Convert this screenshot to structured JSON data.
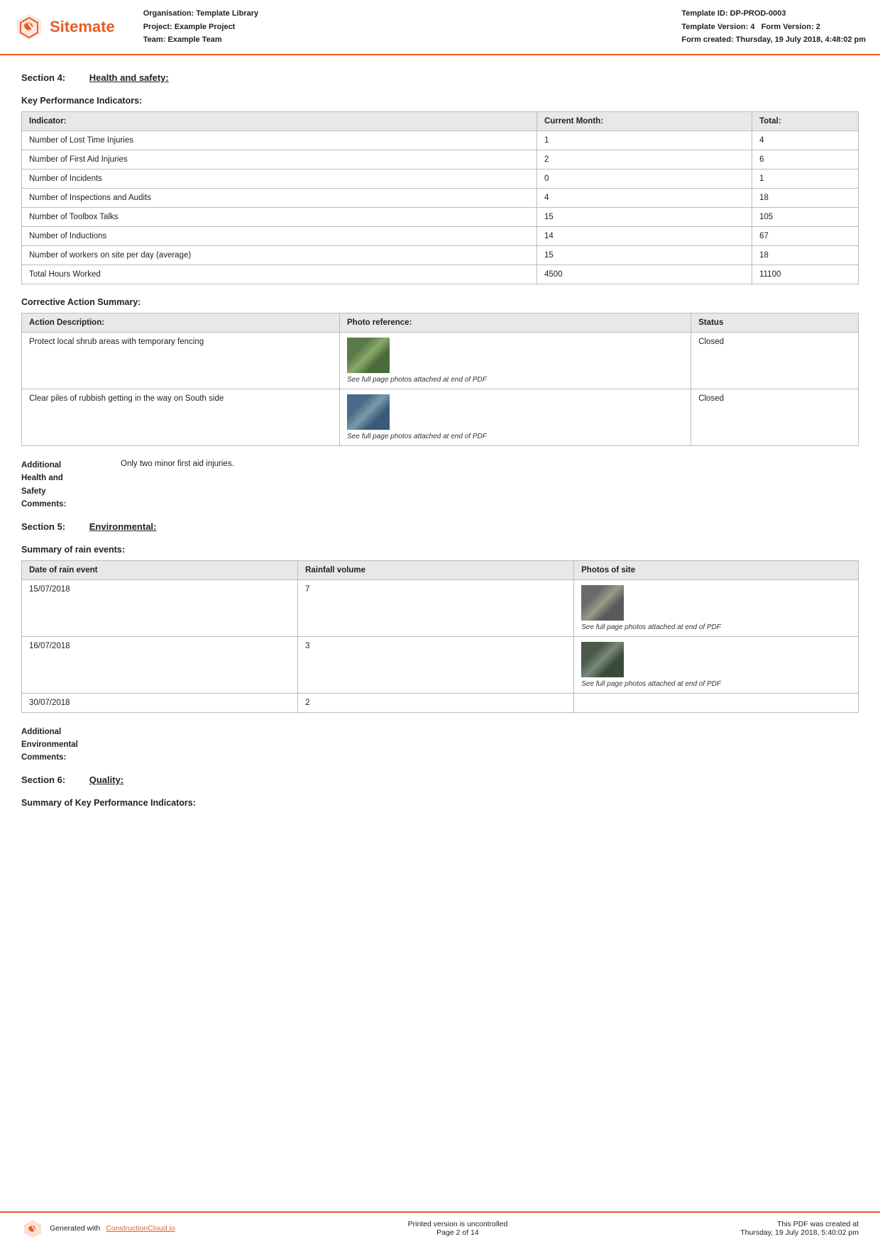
{
  "header": {
    "org_label": "Organisation:",
    "org_value": "Template Library",
    "project_label": "Project:",
    "project_value": "Example Project",
    "team_label": "Team:",
    "team_value": "Example Team",
    "template_id_label": "Template ID:",
    "template_id_value": "DP-PROD-0003",
    "template_version_label": "Template Version:",
    "template_version_value": "4",
    "form_version_label": "Form Version:",
    "form_version_value": "2",
    "form_created_label": "Form created:",
    "form_created_value": "Thursday, 19 July 2018, 4:48:02 pm",
    "logo_text": "Sitemate"
  },
  "section4": {
    "label": "Section 4:",
    "title": "Health and safety:"
  },
  "kpi": {
    "heading": "Key Performance Indicators:",
    "columns": [
      "Indicator:",
      "Current Month:",
      "Total:"
    ],
    "rows": [
      [
        "Number of Lost Time Injuries",
        "1",
        "4"
      ],
      [
        "Number of First Aid Injuries",
        "2",
        "6"
      ],
      [
        "Number of Incidents",
        "0",
        "1"
      ],
      [
        "Number of Inspections and Audits",
        "4",
        "18"
      ],
      [
        "Number of Toolbox Talks",
        "15",
        "105"
      ],
      [
        "Number of Inductions",
        "14",
        "67"
      ],
      [
        "Number of workers on site per day (average)",
        "15",
        "18"
      ],
      [
        "Total Hours Worked",
        "4500",
        "11100"
      ]
    ]
  },
  "corrective": {
    "heading": "Corrective Action Summary:",
    "columns": [
      "Action Description:",
      "Photo reference:",
      "Status"
    ],
    "rows": [
      {
        "description": "Protect local shrub areas with temporary fencing",
        "photo_caption": "See full page photos attached at end of PDF",
        "status": "Closed"
      },
      {
        "description": "Clear piles of rubbish getting in the way on South side",
        "photo_caption": "See full page photos attached at end of PDF",
        "status": "Closed"
      }
    ]
  },
  "additional_hs": {
    "label_line1": "Additional",
    "label_line2": "Health and",
    "label_line3": "Safety",
    "label_line4": "Comments:",
    "value": "Only two minor first aid injuries."
  },
  "section5": {
    "label": "Section 5:",
    "title": "Environmental:"
  },
  "rain": {
    "heading": "Summary of rain events:",
    "columns": [
      "Date of rain event",
      "Rainfall volume",
      "Photos of site"
    ],
    "rows": [
      {
        "date": "15/07/2018",
        "volume": "7",
        "photo_caption": "See full page photos attached at end of PDF"
      },
      {
        "date": "16/07/2018",
        "volume": "3",
        "photo_caption": "See full page photos attached at end of PDF"
      },
      {
        "date": "30/07/2018",
        "volume": "2",
        "photo_caption": ""
      }
    ]
  },
  "additional_env": {
    "label_line1": "Additional",
    "label_line2": "Environmental",
    "label_line3": "Comments:",
    "value": ""
  },
  "section6": {
    "label": "Section 6:",
    "title": "Quality:"
  },
  "kpi_quality": {
    "heading": "Summary of Key Performance Indicators:"
  },
  "footer": {
    "generated_prefix": "Generated with ",
    "link_text": "ConstructionCloud.io",
    "middle_text": "Printed version is uncontrolled",
    "page_info": "Page 2 of 14",
    "right_text": "This PDF was created at",
    "right_date": "Thursday, 19 July 2018, 5:40:02 pm"
  }
}
